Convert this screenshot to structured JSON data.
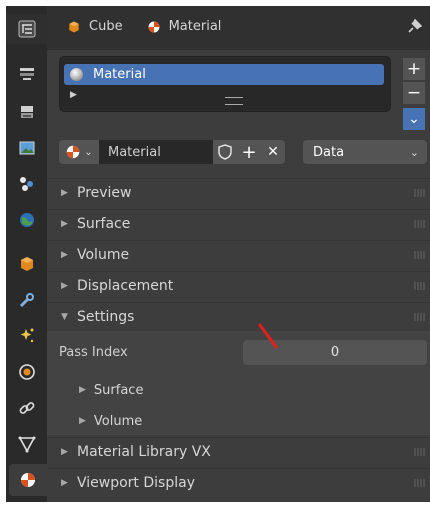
{
  "header": {
    "object_name": "Cube",
    "material_name": "Material"
  },
  "slots": {
    "items": [
      {
        "label": "Material"
      }
    ]
  },
  "side_buttons": {
    "add": "+",
    "remove": "−",
    "more": "⌄"
  },
  "material_selector": {
    "name": "Material",
    "add": "+",
    "close": "✕",
    "link_mode": "Data"
  },
  "panels": [
    {
      "label": "Preview",
      "expanded": false
    },
    {
      "label": "Surface",
      "expanded": false
    },
    {
      "label": "Volume",
      "expanded": false
    },
    {
      "label": "Displacement",
      "expanded": false
    },
    {
      "label": "Settings",
      "expanded": true
    },
    {
      "label": "Material Library VX",
      "expanded": false
    },
    {
      "label": "Viewport Display",
      "expanded": false
    }
  ],
  "settings": {
    "pass_index_label": "Pass Index",
    "pass_index_value": "0",
    "subpanels": [
      {
        "label": "Surface"
      },
      {
        "label": "Volume"
      }
    ]
  },
  "colors": {
    "accent_blue": "#4772b3",
    "annotation_red": "#e0201c",
    "orange": "#e08a1e"
  }
}
